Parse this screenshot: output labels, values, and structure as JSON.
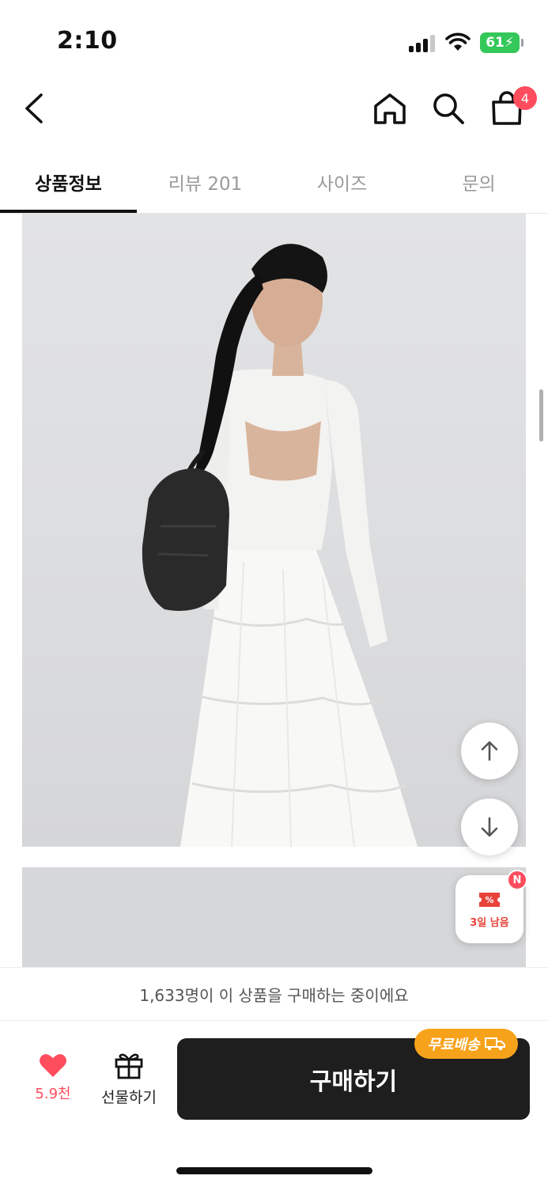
{
  "status_bar": {
    "time": "2:10",
    "battery": "61"
  },
  "header": {
    "cart_count": "4",
    "icons": [
      "chevron-left-icon",
      "home-icon",
      "search-icon",
      "shopping-bag-icon"
    ]
  },
  "tabs": [
    {
      "label": "상품정보",
      "active": true
    },
    {
      "label": "리뷰 201",
      "active": false
    },
    {
      "label": "사이즈",
      "active": false
    },
    {
      "label": "문의",
      "active": false
    }
  ],
  "floating": {
    "coupon_label": "3일 남음",
    "coupon_badge": "N"
  },
  "purchase_notice": "1,633명이 이 상품을 구매하는 중이에요",
  "bottom_bar": {
    "like_count": "5.9천",
    "gift_label": "선물하기",
    "buy_label": "구매하기",
    "free_shipping_label": "무료배송"
  },
  "colors": {
    "accent_red": "#ff4d5e",
    "buy_button": "#1e1e1e",
    "free_shipping": "#f7a21b",
    "battery": "#34c759"
  }
}
